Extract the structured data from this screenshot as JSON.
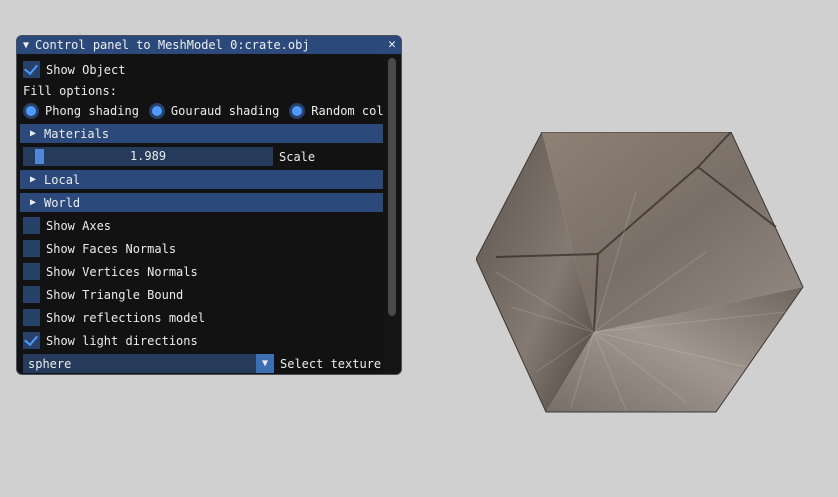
{
  "window": {
    "title": "Control panel to MeshModel 0:crate.obj",
    "close_glyph": "✕"
  },
  "show_object": {
    "label": "Show Object",
    "checked": true
  },
  "fill_options": {
    "label": "Fill options:",
    "options": [
      {
        "label": "Phong shading",
        "selected": true
      },
      {
        "label": "Gouraud shading",
        "selected": true
      },
      {
        "label": "Random color",
        "selected": true
      }
    ]
  },
  "sections": {
    "materials": "Materials",
    "local": "Local",
    "world": "World"
  },
  "scale": {
    "value": "1.989",
    "label": "Scale",
    "fraction": 0.06
  },
  "toggles": [
    {
      "label": "Show Axes",
      "checked": false
    },
    {
      "label": "Show Faces Normals",
      "checked": false
    },
    {
      "label": "Show Vertices Normals",
      "checked": false
    },
    {
      "label": "Show Triangle Bound",
      "checked": false
    },
    {
      "label": "Show reflections model",
      "checked": false
    },
    {
      "label": "Show light directions",
      "checked": true
    }
  ],
  "texture": {
    "value": "sphere",
    "label": "Select texture m"
  },
  "colors": {
    "accent": "#4f9aff",
    "header": "#2b4a7b",
    "panel_bg": "#121212",
    "viewport_bg": "#d0d0d0"
  }
}
